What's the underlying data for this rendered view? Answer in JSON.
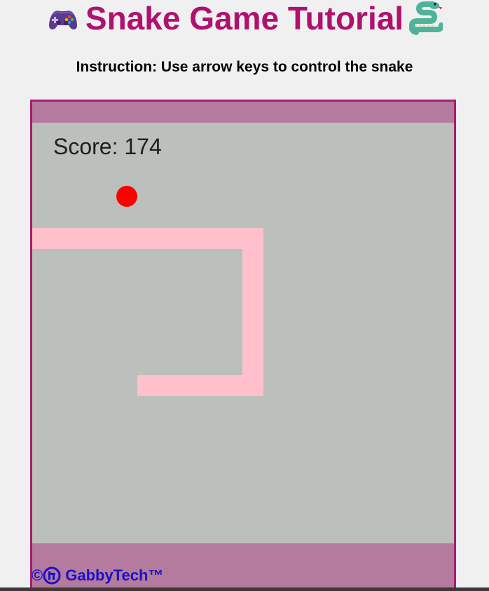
{
  "header": {
    "title": "Snake Game Tutorial",
    "left_icon": "game-controller-icon",
    "right_icon": "snake-icon",
    "title_color": "#b0116f"
  },
  "instruction": "Instruction: Use arrow keys to control the snake",
  "game": {
    "score_label": "Score: 174",
    "board_color": "#bbc0bc",
    "frame_color": "#b57b9e",
    "border_color": "#ac1a6e",
    "snake_color": "#ffc0cb",
    "food_color": "#ff0000",
    "grid_cols": 20,
    "grid_rows": 20,
    "food_cell": [
      4,
      3
    ],
    "snake_cells": [
      [
        5,
        12
      ],
      [
        6,
        12
      ],
      [
        7,
        12
      ],
      [
        8,
        12
      ],
      [
        9,
        12
      ],
      [
        10,
        12
      ],
      [
        10,
        11
      ],
      [
        10,
        10
      ],
      [
        10,
        9
      ],
      [
        10,
        8
      ],
      [
        10,
        7
      ],
      [
        10,
        6
      ],
      [
        10,
        5
      ],
      [
        9,
        5
      ],
      [
        8,
        5
      ],
      [
        7,
        5
      ],
      [
        6,
        5
      ],
      [
        5,
        5
      ],
      [
        4,
        5
      ],
      [
        3,
        5
      ],
      [
        2,
        5
      ],
      [
        1,
        5
      ],
      [
        0,
        5
      ]
    ]
  },
  "footer": {
    "copyright": "©",
    "brand_icon": "gabbytech-logo-icon",
    "brand": "GabbyTech™",
    "color": "#1a10c8"
  }
}
